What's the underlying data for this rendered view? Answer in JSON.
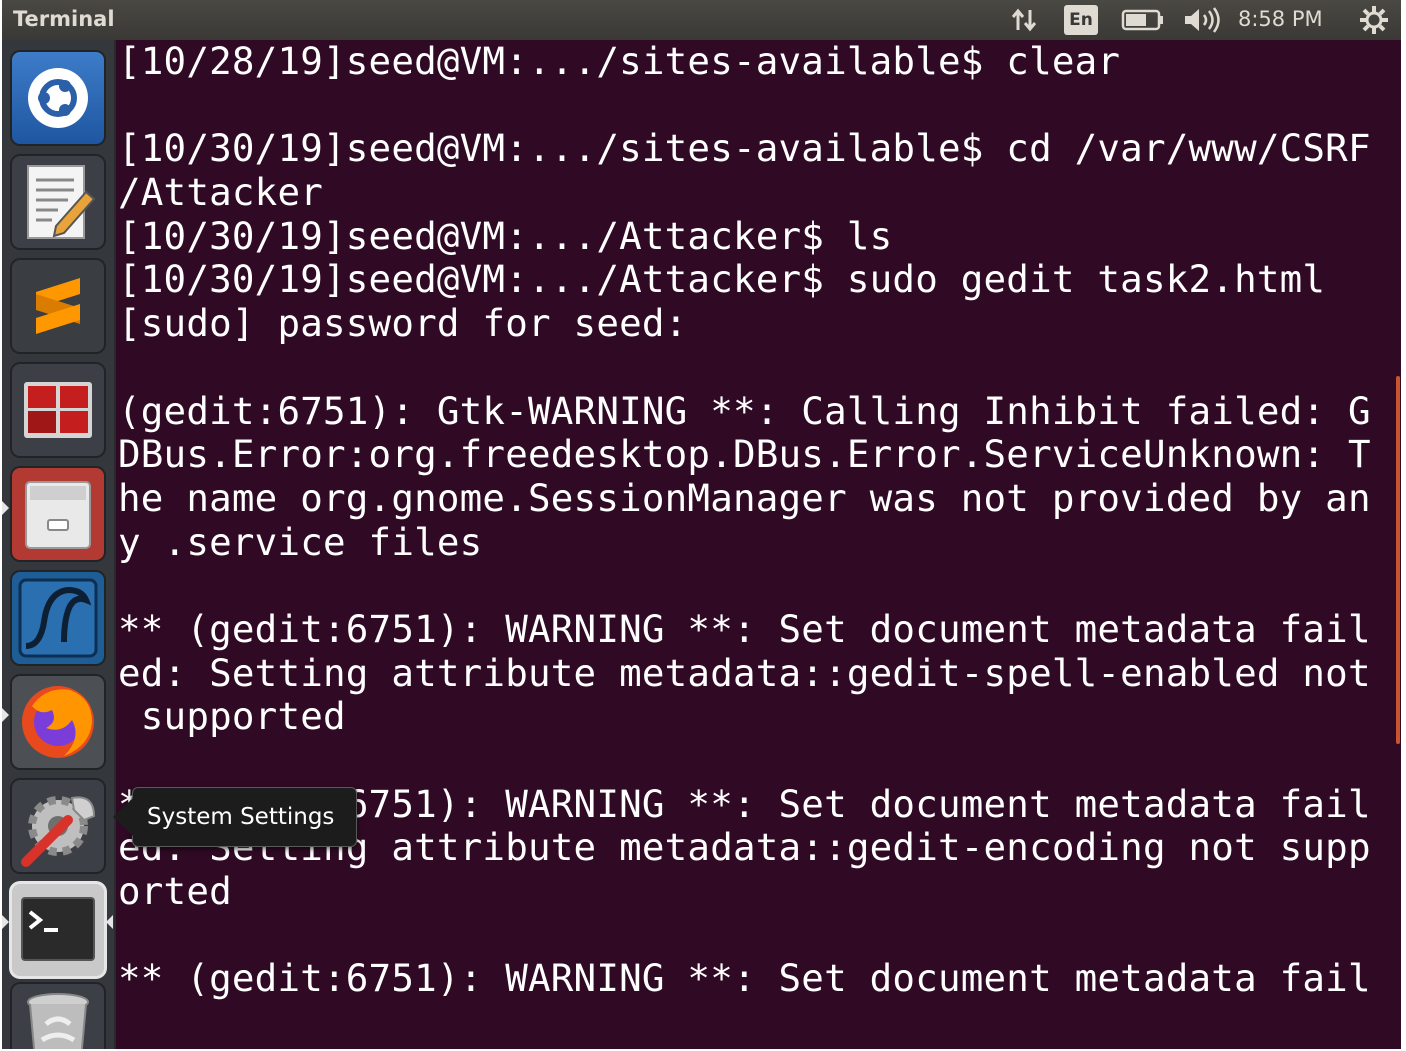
{
  "window": {
    "title": "Terminal"
  },
  "panel": {
    "keyboard_layout": "En",
    "clock": "8:58 PM",
    "indicators": [
      "network-icon",
      "keyboard-icon",
      "battery-icon",
      "volume-icon",
      "settings-icon"
    ]
  },
  "launcher": {
    "items": [
      {
        "name": "ubuntu-dash",
        "icon": "ubuntu-logo-icon"
      },
      {
        "name": "text-editor",
        "icon": "text-editor-icon"
      },
      {
        "name": "sublime-text",
        "icon": "sublime-text-icon"
      },
      {
        "name": "workspace-switcher",
        "icon": "workspace-switcher-icon"
      },
      {
        "name": "files",
        "icon": "file-cabinet-icon"
      },
      {
        "name": "wireshark",
        "icon": "wireshark-fin-icon"
      },
      {
        "name": "firefox",
        "icon": "firefox-icon"
      },
      {
        "name": "system-settings",
        "icon": "settings-wrench-icon"
      },
      {
        "name": "terminal",
        "icon": "terminal-icon"
      },
      {
        "name": "trash",
        "icon": "trash-icon"
      }
    ],
    "tooltip": "System Settings"
  },
  "terminal": {
    "lines": [
      "[10/28/19]seed@VM:.../sites-available$ clear",
      "",
      "[10/30/19]seed@VM:.../sites-available$ cd /var/www/CSRF",
      "/Attacker",
      "[10/30/19]seed@VM:.../Attacker$ ls",
      "[10/30/19]seed@VM:.../Attacker$ sudo gedit task2.html",
      "[sudo] password for seed:",
      "",
      "(gedit:6751): Gtk-WARNING **: Calling Inhibit failed: G",
      "DBus.Error:org.freedesktop.DBus.Error.ServiceUnknown: T",
      "he name org.gnome.SessionManager was not provided by an",
      "y .service files",
      "",
      "** (gedit:6751): WARNING **: Set document metadata fail",
      "ed: Setting attribute metadata::gedit-spell-enabled not",
      " supported",
      "",
      "** (gedit:6751): WARNING **: Set document metadata fail",
      "ed: Setting attribute metadata::gedit-encoding not supp",
      "orted",
      "",
      "** (gedit:6751): WARNING **: Set document metadata fail"
    ]
  },
  "colors": {
    "terminal_background": "#300a24",
    "terminal_text": "#ffffff",
    "panel_background": "#3a3935",
    "launcher_background": "#34383d",
    "scrollbar_accent": "#c8552d"
  }
}
